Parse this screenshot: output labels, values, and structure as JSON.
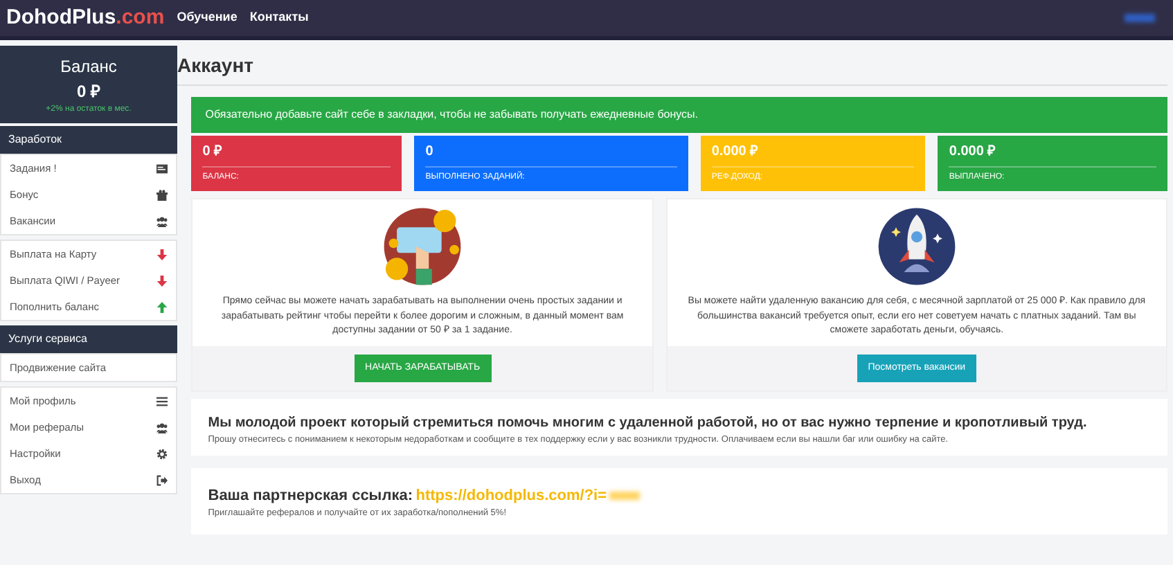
{
  "navbar": {
    "logo_main": "DohodPlus",
    "logo_suffix": ".com",
    "links": [
      "Обучение",
      "Контакты"
    ]
  },
  "balance": {
    "title": "Баланс",
    "amount": "0 ₽",
    "note": "+2% на остаток в мес."
  },
  "sidebar": [
    {
      "header": "Заработок",
      "groups": [
        [
          "Задания !",
          "Бонус",
          "Вакансии"
        ],
        [
          "Выплата на Карту",
          "Выплата QIWI / Payeer",
          "Пополнить баланс"
        ]
      ]
    },
    {
      "header": "Услуги сервиса",
      "groups": [
        [
          "Продвижение сайта"
        ],
        [
          "Мой профиль",
          "Мои рефералы",
          "Настройки",
          "Выход"
        ]
      ]
    }
  ],
  "page_title": "Аккаунт",
  "alert": "Обязательно добавьте сайт себе в закладки, чтобы не забывать получать ежедневные бонусы.",
  "stats": [
    {
      "value": "0 ₽",
      "label": "БАЛАНС:",
      "color": "#dc3545"
    },
    {
      "value": "0",
      "label": "ВЫПОЛНЕНО ЗАДАНИЙ:",
      "color": "#0d6efd"
    },
    {
      "value": "0.000 ₽",
      "label": "РЕФ.ДОХОД:",
      "color": "#ffc107"
    },
    {
      "value": "0.000 ₽",
      "label": "ВЫПЛАЧЕНО:",
      "color": "#28a745"
    }
  ],
  "offers": [
    {
      "kind": "coins",
      "text": "Прямо сейчас вы можете начать зарабатывать на выполнении очень простых задании и зарабатывать рейтинг чтобы перейти к более дорогим и сложным, в данный момент вам доступны задании от 50 ₽ за 1 задание.",
      "button": {
        "label": "НАЧАТЬ ЗАРАБАТЫВАТЬ",
        "color": "#28a745"
      }
    },
    {
      "kind": "rocket",
      "text": "Вы можете найти удаленную вакансию для себя, с месячной зарплатой от 25 000 ₽. Как правило для большинства вакансий требуется опыт, если его нет советуем начать с платных заданий. Там вы сможете заработать деньги, обучаясь.",
      "button": {
        "label": "Посмотреть вакансии",
        "color": "#17a2b8"
      }
    }
  ],
  "notice": {
    "heading": "Мы молодой проект который стремиться помочь многим с удаленной работой, но от вас нужно терпение и кропотливый труд.",
    "text": "Прошу отнеситесь с пониманием к некоторым недоработкам и сообщите в тех поддержку если у вас возникли трудности. Оплачиваем если вы нашли баг или ошибку на сайте."
  },
  "partner": {
    "label": "Ваша партнерская ссылка:",
    "link": "https://dohodplus.com/?i=",
    "text": "Приглашайте рефералов и получайте от их заработка/пополнений 5%!"
  }
}
